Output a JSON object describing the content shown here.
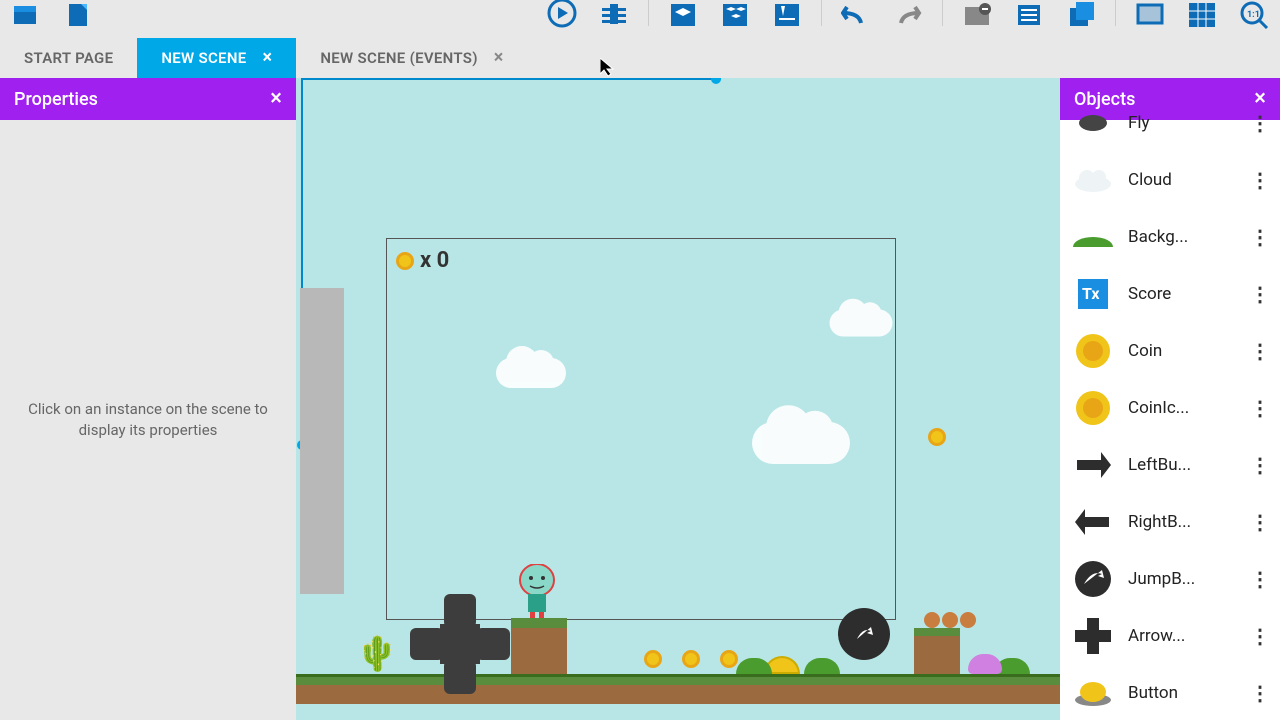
{
  "tabs": {
    "start": "START PAGE",
    "scene": "NEW SCENE",
    "events": "NEW SCENE (EVENTS)"
  },
  "properties": {
    "title": "Properties",
    "empty": "Click on an instance on the scene to display its properties"
  },
  "objects_panel": {
    "title": "Objects"
  },
  "scene": {
    "score_text": "x 0"
  },
  "objects": [
    {
      "name": "Fly"
    },
    {
      "name": "Cloud"
    },
    {
      "name": "Backg..."
    },
    {
      "name": "Score"
    },
    {
      "name": "Coin"
    },
    {
      "name": "CoinIc..."
    },
    {
      "name": "LeftBu..."
    },
    {
      "name": "RightB..."
    },
    {
      "name": "JumpB..."
    },
    {
      "name": "Arrow..."
    },
    {
      "name": "Button"
    }
  ]
}
